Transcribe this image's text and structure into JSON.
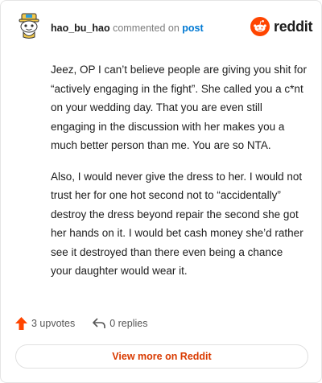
{
  "header": {
    "username": "hao_bu_hao",
    "commented_text": "commented on",
    "post_link": "post",
    "avatar_icon": "snoo-avatar-icon",
    "logo_icon": "reddit-alien-icon",
    "logo_text": "reddit"
  },
  "comment": {
    "paragraphs": [
      "Jeez, OP I can’t believe people are giving you shit for “actively engaging in the fight”. She called you a c*nt on your wedding day. That you are even still engaging in the discussion with her makes you a much better person than me. You are so NTA.",
      "Also, I would never give the dress to her. I would not trust her for one hot second not to “accidentally” destroy the dress beyond repair the second she got her hands on it. I would bet cash money she’d rather see it destroyed than there even being a chance your daughter would wear it."
    ]
  },
  "actions": {
    "upvotes_label": "3 upvotes",
    "upvote_icon": "upvote-arrow-icon",
    "replies_label": "0 replies",
    "reply_icon": "reply-arrow-icon"
  },
  "footer": {
    "view_more_label": "View more on Reddit"
  },
  "colors": {
    "accent": "#d93a00",
    "upvote": "#ff4500",
    "link": "#0079d3"
  }
}
